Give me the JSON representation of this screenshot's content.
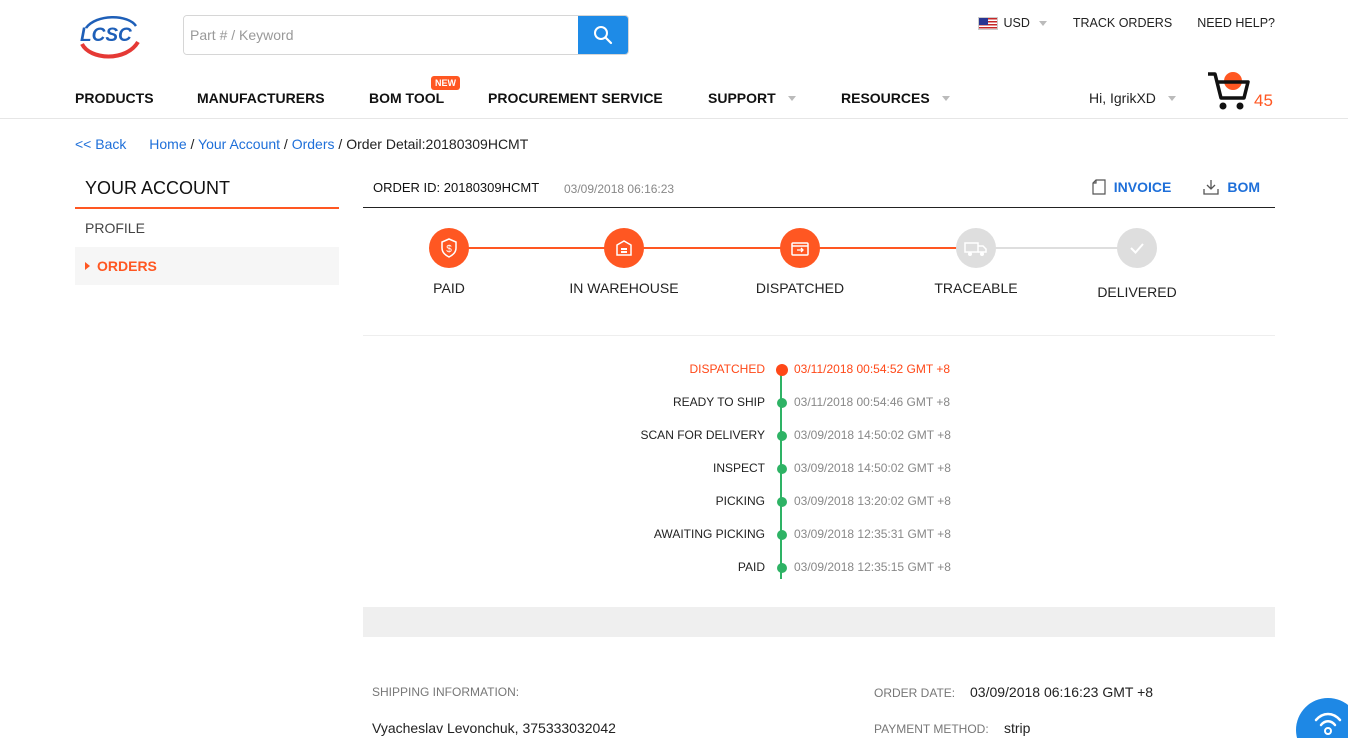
{
  "header": {
    "logo_text": "LCSC",
    "search_placeholder": "Part # / Keyword",
    "currency": "USD",
    "track_orders": "TRACK ORDERS",
    "need_help": "NEED HELP?",
    "greeting": "Hi, IgrikXD",
    "cart_count": "45"
  },
  "nav": {
    "products": "PRODUCTS",
    "manufacturers": "MANUFACTURERS",
    "bom_tool": "BOM TOOL",
    "new_badge": "NEW",
    "procurement": "PROCUREMENT SERVICE",
    "support": "SUPPORT",
    "resources": "RESOURCES"
  },
  "breadcrumb": {
    "back": "<< Back",
    "home": "Home",
    "account": "Your Account",
    "orders": "Orders",
    "current": "Order Detail:20180309HCMT"
  },
  "sidebar": {
    "title": "YOUR ACCOUNT",
    "profile": "PROFILE",
    "orders": "ORDERS"
  },
  "order": {
    "id_label": "ORDER ID: 20180309HCMT",
    "date": "03/09/2018 06:16:23",
    "invoice": "INVOICE",
    "bom": "BOM"
  },
  "steps": [
    {
      "label": "PAID",
      "done": true
    },
    {
      "label": "IN WAREHOUSE",
      "done": true
    },
    {
      "label": "DISPATCHED",
      "done": true
    },
    {
      "label": "TRACEABLE",
      "done": false
    },
    {
      "label": "DELIVERED",
      "done": false
    }
  ],
  "timeline": [
    {
      "event": "DISPATCHED",
      "time": "03/11/2018 00:54:52 GMT +8",
      "active": true
    },
    {
      "event": "READY TO SHIP",
      "time": "03/11/2018 00:54:46 GMT +8",
      "active": false
    },
    {
      "event": "SCAN FOR DELIVERY",
      "time": "03/09/2018 14:50:02 GMT +8",
      "active": false
    },
    {
      "event": "INSPECT",
      "time": "03/09/2018 14:50:02 GMT +8",
      "active": false
    },
    {
      "event": "PICKING",
      "time": "03/09/2018 13:20:02 GMT +8",
      "active": false
    },
    {
      "event": "AWAITING PICKING",
      "time": "03/09/2018 12:35:31 GMT +8",
      "active": false
    },
    {
      "event": "PAID",
      "time": "03/09/2018 12:35:15 GMT +8",
      "active": false
    }
  ],
  "shipping": {
    "title": "SHIPPING INFORMATION:",
    "name": "Vyacheslav Levonchuk, 375333032042"
  },
  "info": {
    "order_date_label": "ORDER DATE:",
    "order_date": "03/09/2018 06:16:23 GMT +8",
    "payment_label": "PAYMENT METHOD:",
    "payment": "strip"
  },
  "colors": {
    "accent": "#ff5722",
    "link": "#1e6fd9",
    "success": "#2eb365",
    "pending": "#dedede"
  }
}
